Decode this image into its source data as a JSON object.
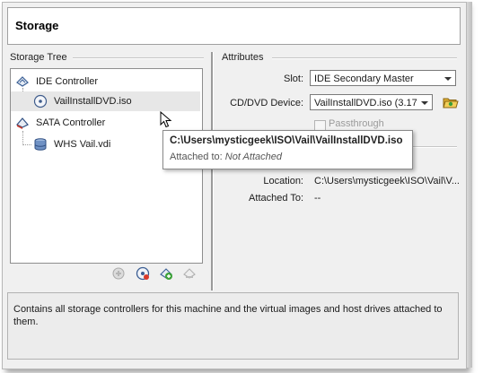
{
  "header": {
    "title": "Storage"
  },
  "storage_tree": {
    "label": "Storage Tree",
    "items": [
      {
        "label": "IDE Controller",
        "kind": "controller",
        "icon": "ide-controller-icon"
      },
      {
        "label": "VailInstallDVD.iso",
        "kind": "attachment",
        "icon": "cd-dvd-icon",
        "selected": true
      },
      {
        "label": "SATA Controller",
        "kind": "controller",
        "icon": "sata-controller-icon"
      },
      {
        "label": "WHS Vail.vdi",
        "kind": "attachment",
        "icon": "hard-disk-icon"
      }
    ],
    "toolbar": [
      {
        "name": "add-controller-button",
        "icon": "add-controller-icon"
      },
      {
        "name": "add-cd-button",
        "icon": "add-cd-icon"
      },
      {
        "name": "add-attachment-button",
        "icon": "add-attachment-icon"
      },
      {
        "name": "remove-attachment-button",
        "icon": "remove-attachment-icon"
      }
    ]
  },
  "attributes": {
    "label": "Attributes",
    "slot_label": "Slot:",
    "slot_value": "IDE Secondary Master",
    "device_label": "CD/DVD Device:",
    "device_value": "VailInstallDVD.iso (3.17",
    "passthrough_label": "Passthrough",
    "location_label": "Location:",
    "location_value": "C:\\Users\\mysticgeek\\ISO\\Vail\\V...",
    "attached_label": "Attached To:",
    "attached_value": "--"
  },
  "tooltip": {
    "path": "C:\\Users\\mysticgeek\\ISO\\Vail\\VailInstallDVD.iso",
    "attached_prefix": "Attached to:",
    "attached_value": "Not Attached"
  },
  "description": "Contains all storage controllers for this machine and the virtual images and host drives attached to them.",
  "colors": {
    "selection": "#e7e7e7",
    "panel": "#f0f0f0",
    "folder": "#d9a21b"
  }
}
